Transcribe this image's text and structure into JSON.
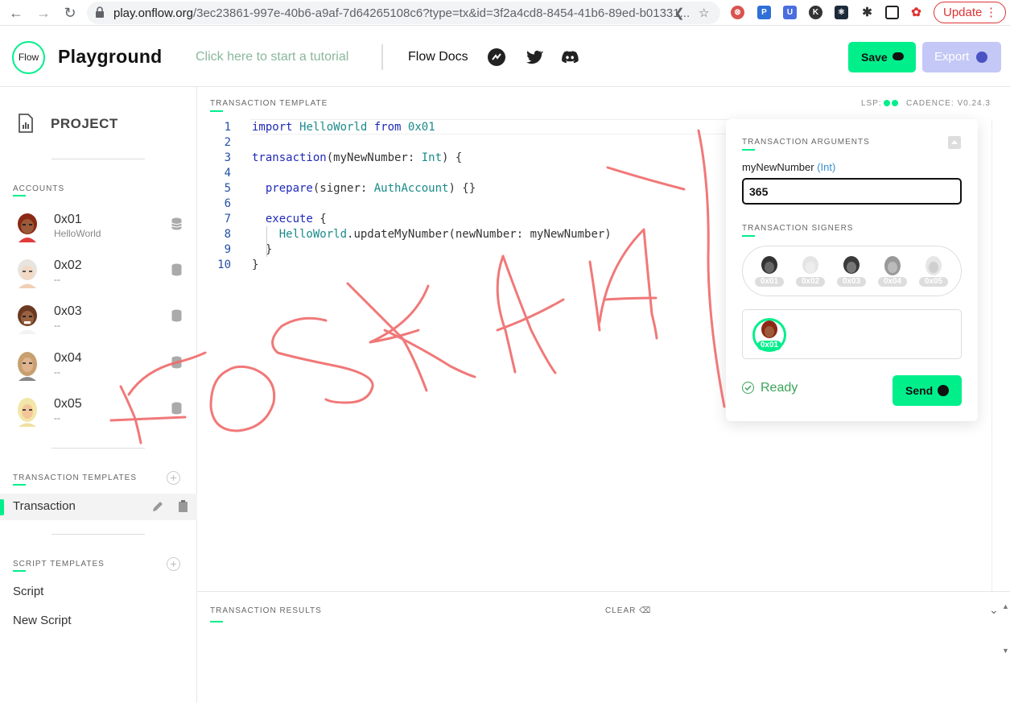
{
  "browser": {
    "url_domain": "play.onflow.org",
    "url_path": "/3ec23861-997e-40b6-a9af-7d64265108c6?type=tx&id=3f2a4cd8-8454-41b6-89ed-b01331...",
    "update_label": "Update"
  },
  "header": {
    "logo_text": "Flow",
    "title": "Playground",
    "tutorial_link": "Click here to start a tutorial",
    "docs_link": "Flow Docs",
    "save_label": "Save",
    "export_label": "Export"
  },
  "sidebar": {
    "project_label": "PROJECT",
    "accounts_label": "ACCOUNTS",
    "accounts": [
      {
        "address": "0x01",
        "contract": "HelloWorld"
      },
      {
        "address": "0x02",
        "contract": "--"
      },
      {
        "address": "0x03",
        "contract": "--"
      },
      {
        "address": "0x04",
        "contract": "--"
      },
      {
        "address": "0x05",
        "contract": "--"
      }
    ],
    "tx_templates_label": "TRANSACTION TEMPLATES",
    "tx_templates": [
      "Transaction"
    ],
    "script_templates_label": "SCRIPT TEMPLATES",
    "script_templates": [
      "Script",
      "New Script"
    ]
  },
  "editor": {
    "label": "TRANSACTION TEMPLATE",
    "lsp_label": "LSP:",
    "cadence_label": "CADENCE: V0.24.3",
    "line_numbers": [
      "1",
      "2",
      "3",
      "4",
      "5",
      "6",
      "7",
      "8",
      "9",
      "10"
    ]
  },
  "results": {
    "label": "TRANSACTION RESULTS",
    "clear_label": "CLEAR"
  },
  "tx_panel": {
    "arguments_label": "TRANSACTION ARGUMENTS",
    "arg_name": "myNewNumber",
    "arg_type": "(Int)",
    "arg_value": "365",
    "signers_label": "TRANSACTION SIGNERS",
    "signers": [
      "0x01",
      "0x02",
      "0x03",
      "0x04",
      "0x05"
    ],
    "selected_signer": "0x01",
    "status": "Ready",
    "send_label": "Send"
  },
  "colors": {
    "accent": "#00ef8b",
    "export_button": "#c4c8f6",
    "doodle": "#f06a6a"
  }
}
